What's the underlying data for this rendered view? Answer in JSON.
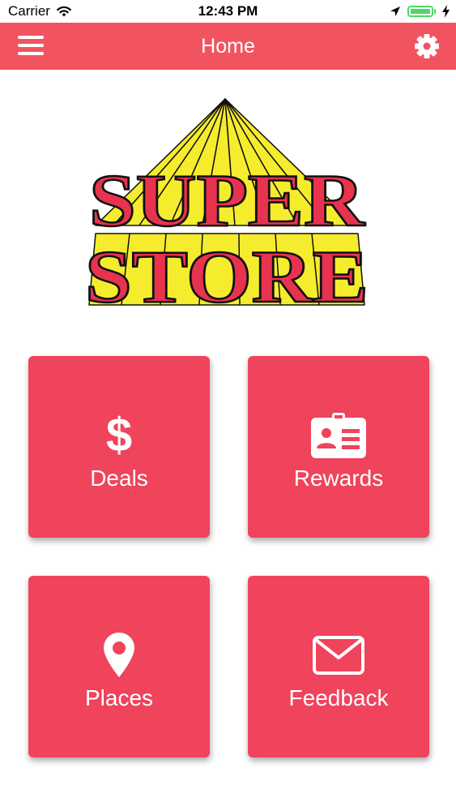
{
  "status_bar": {
    "carrier": "Carrier",
    "time": "12:43 PM",
    "icons": [
      "wifi-icon",
      "location-arrow-icon",
      "battery-icon",
      "charging-icon"
    ]
  },
  "nav": {
    "title": "Home",
    "left_icon": "hamburger-menu-icon",
    "right_icon": "gear-icon"
  },
  "logo": {
    "line1": "SUPER",
    "line2": "STORE",
    "colors": {
      "text": "#e8334f",
      "rays": "#f5ec2e",
      "outline": "#111111"
    }
  },
  "tiles": [
    {
      "label": "Deals",
      "icon": "dollar-icon"
    },
    {
      "label": "Rewards",
      "icon": "id-card-icon"
    },
    {
      "label": "Places",
      "icon": "map-pin-icon"
    },
    {
      "label": "Feedback",
      "icon": "envelope-icon"
    }
  ],
  "colors": {
    "nav_bar": "#f2545f",
    "tile": "#f0435c",
    "battery": "#4cd964"
  }
}
